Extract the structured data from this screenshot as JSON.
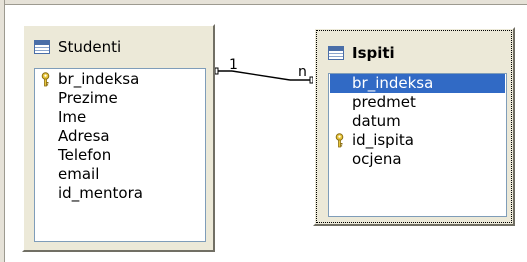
{
  "tables": [
    {
      "title": "Studenti",
      "fields": [
        {
          "name": "br_indeksa",
          "key": true
        },
        {
          "name": "Prezime",
          "key": false
        },
        {
          "name": "Ime",
          "key": false
        },
        {
          "name": "Adresa",
          "key": false
        },
        {
          "name": "Telefon",
          "key": false
        },
        {
          "name": "email",
          "key": false
        },
        {
          "name": "id_mentora",
          "key": false
        }
      ]
    },
    {
      "title": "Ispiti",
      "fields": [
        {
          "name": "br_indeksa",
          "key": false,
          "selected": true
        },
        {
          "name": "predmet",
          "key": false
        },
        {
          "name": "datum",
          "key": false
        },
        {
          "name": "id_ispita",
          "key": true
        },
        {
          "name": "ocjena",
          "key": false
        }
      ]
    }
  ],
  "relation": {
    "from_cardinality": "1",
    "to_cardinality": "n"
  },
  "colors": {
    "selection": "#316ac5",
    "key_icon": "#e8c63a",
    "window_bg": "#ece9d8"
  }
}
